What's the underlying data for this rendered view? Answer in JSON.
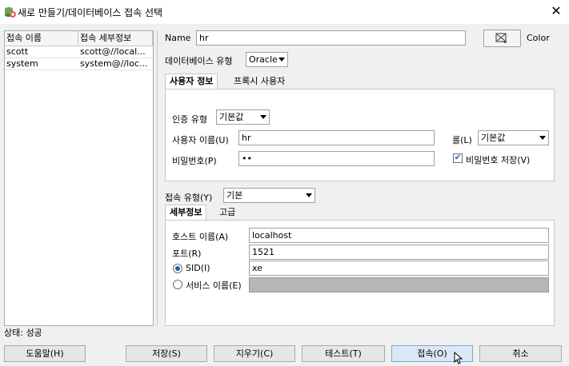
{
  "window": {
    "title": "새로 만들기/데이터베이스 접속 선택",
    "close_glyph": "✕"
  },
  "connections": {
    "columns": [
      "접속 이름",
      "접속 세부정보"
    ],
    "rows": [
      {
        "name": "scott",
        "details": "scott@//local..."
      },
      {
        "name": "system",
        "details": "system@//loc..."
      }
    ]
  },
  "form": {
    "name_label": "Name",
    "name_value": "hr",
    "color_label": "Color",
    "db_type_label": "데이터베이스 유형",
    "db_type_value": "Oracle",
    "user_tabs": [
      "사용자 정보",
      "프록시 사용자"
    ],
    "auth_type_label": "인증 유형",
    "auth_type_value": "기본값",
    "username_label": "사용자 이름(U)",
    "username_value": "hr",
    "role_label": "롤(L)",
    "role_value": "기본값",
    "password_label": "비밀번호(P)",
    "password_value": "••",
    "save_password_label": "비밀번호 저장(V)",
    "save_password_checked": true,
    "conn_type_label": "접속 유형(Y)",
    "conn_type_value": "기본",
    "detail_tabs": [
      "세부정보",
      "고급"
    ],
    "host_label": "호스트 이름(A)",
    "host_value": "localhost",
    "port_label": "포트(R)",
    "port_value": "1521",
    "sid_label": "SID(I)",
    "sid_value": "xe",
    "service_label": "서비스 이름(E)",
    "service_value": ""
  },
  "status": {
    "text": "상태: 성공"
  },
  "buttons": {
    "help": "도움말(H)",
    "save": "저장(S)",
    "clear": "지우기(C)",
    "test": "테스트(T)",
    "connect": "접속(O)",
    "cancel": "취소"
  }
}
